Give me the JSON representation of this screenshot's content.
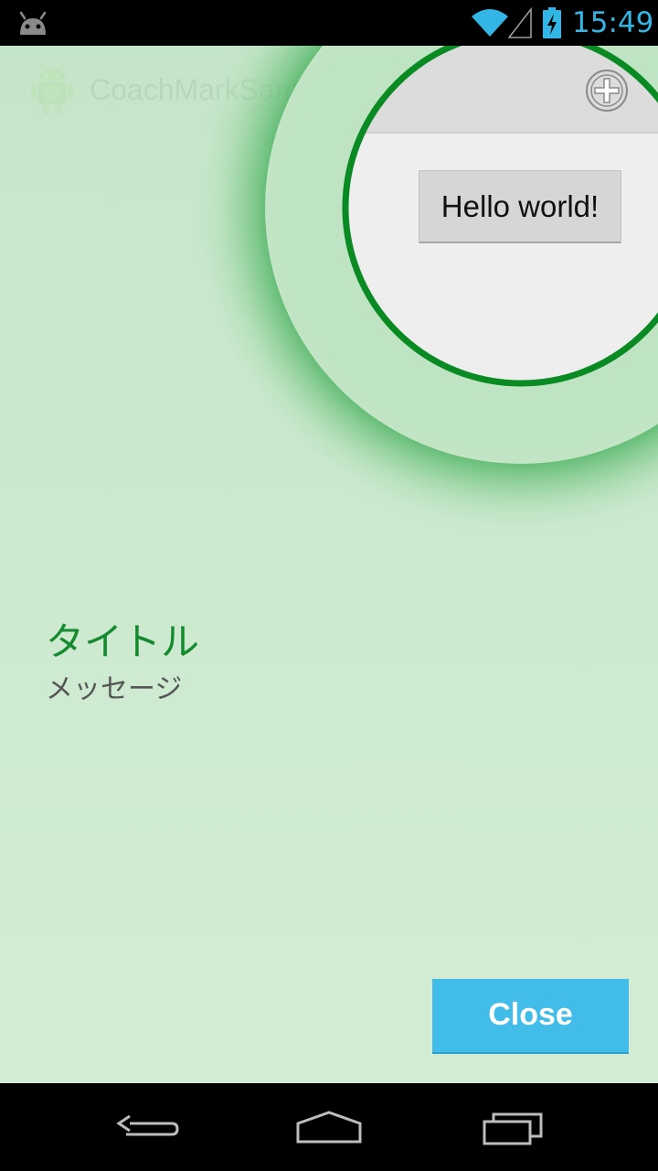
{
  "status_bar": {
    "time": "15:49",
    "icons": [
      "android-notification-icon",
      "wifi-icon",
      "cell-signal-icon",
      "battery-charging-icon"
    ]
  },
  "app_bar": {
    "title": "CoachMarkSample",
    "icon": "android-launcher-icon",
    "action_icon": "add-circle-icon"
  },
  "content": {
    "hello_button_label": "Hello world!"
  },
  "coach_mark": {
    "title": "タイトル",
    "message": "メッセージ",
    "close_label": "Close",
    "overlay_color": "#c8e8ca",
    "ring_color": "#0a8a22",
    "title_color": "#138a2e",
    "close_color": "#42bce9"
  },
  "nav_bar": {
    "icons": [
      "back-icon",
      "home-icon",
      "recents-icon"
    ]
  }
}
